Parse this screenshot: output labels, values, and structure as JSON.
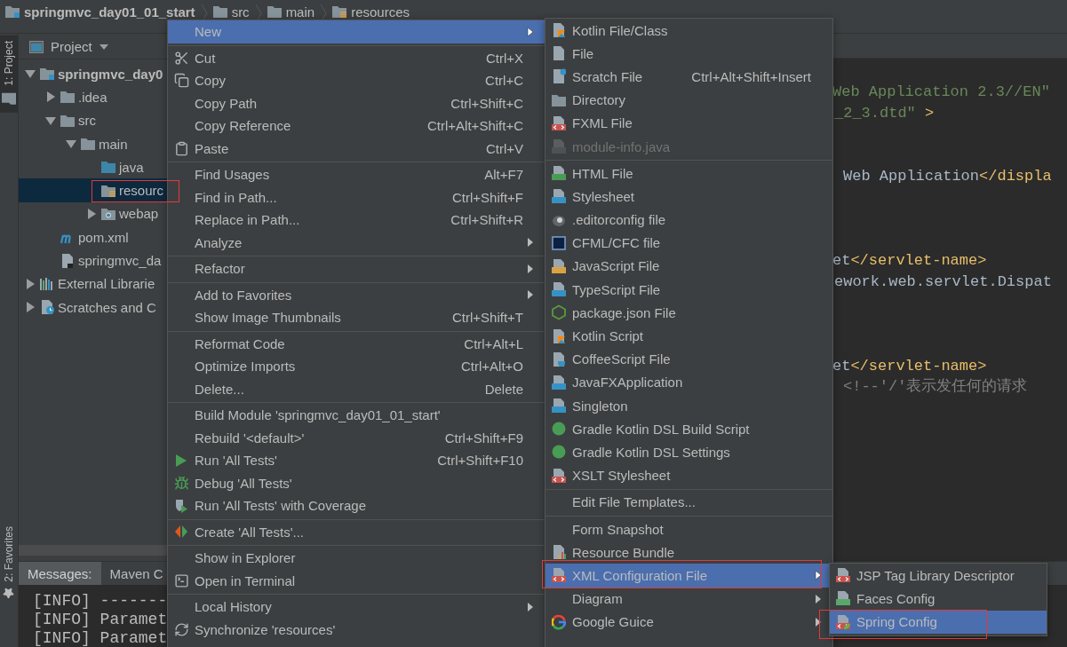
{
  "breadcrumb": [
    {
      "label": "springmvc_day01_01_start",
      "kind": "module"
    },
    {
      "label": "src",
      "kind": "folder"
    },
    {
      "label": "main",
      "kind": "folder"
    },
    {
      "label": "resources",
      "kind": "resources"
    }
  ],
  "side_tabs": [
    {
      "label": "1: Project",
      "kind": "folder",
      "selected": true
    },
    {
      "label": "2: Favorites",
      "kind": "star",
      "selected": false
    }
  ],
  "project_panel": {
    "title": "Project",
    "tree": [
      {
        "label": "springmvc_day0",
        "kind": "module",
        "expanded": true,
        "selected": false,
        "children": [
          {
            "label": ".idea",
            "kind": "folder",
            "expanded": false,
            "selected": false
          },
          {
            "label": "src",
            "kind": "folder",
            "expanded": true,
            "selected": false,
            "children": [
              {
                "label": "main",
                "kind": "folder",
                "expanded": true,
                "selected": false,
                "children": [
                  {
                    "label": "java",
                    "kind": "sources",
                    "selected": false
                  },
                  {
                    "label": "resourc",
                    "kind": "resources",
                    "selected": true
                  },
                  {
                    "label": "webap",
                    "kind": "web",
                    "expanded": false,
                    "selected": false
                  }
                ]
              }
            ]
          },
          {
            "label": "pom.xml",
            "kind": "maven",
            "selected": false
          },
          {
            "label": "springmvc_da",
            "kind": "iml",
            "selected": false
          }
        ]
      },
      {
        "label": "External Librarie",
        "kind": "libraries",
        "expanded": false,
        "selected": false
      },
      {
        "label": "Scratches and C",
        "kind": "scratches",
        "expanded": false,
        "selected": false
      }
    ]
  },
  "editor": {
    "lines": [
      {
        "segments": [
          {
            "text": "Web Application 2.3//EN\"",
            "kind": "string"
          }
        ]
      },
      {
        "segments": [
          {
            "text": "_2_3.dtd\"",
            "kind": "string"
          },
          {
            "text": " >",
            "kind": "tag"
          }
        ]
      },
      {
        "segments": [
          {
            "text": "Web Application",
            "kind": "text"
          },
          {
            "text": "</displa",
            "kind": "tag"
          }
        ]
      },
      {
        "segments": [
          {
            "text": "et",
            "kind": "text"
          },
          {
            "text": "</servlet-name>",
            "kind": "tag"
          }
        ]
      },
      {
        "segments": [
          {
            "text": "ework.web.servlet.Dispat",
            "kind": "text"
          }
        ]
      },
      {
        "segments": [
          {
            "text": "et",
            "kind": "text"
          },
          {
            "text": "</servlet-name>",
            "kind": "tag"
          }
        ]
      },
      {
        "segments": [
          {
            "text": "<!--'/'表示发任何的请求",
            "kind": "comment"
          }
        ]
      }
    ]
  },
  "bottom_panel": {
    "tabs": [
      {
        "label": "Messages:",
        "selected": true
      },
      {
        "label": "Maven C",
        "selected": false
      }
    ],
    "console": [
      "[INFO] -------",
      "[INFO] Paramet",
      "[INFO] Paramet"
    ]
  },
  "context_menu": {
    "items": [
      {
        "kind": "plain",
        "label": "New",
        "submenu": true,
        "selected": true
      },
      {
        "kind": "separator"
      },
      {
        "kind": "cut",
        "label": "Cut",
        "shortcut": "Ctrl+X",
        "selected": false
      },
      {
        "kind": "copy",
        "label": "Copy",
        "shortcut": "Ctrl+C",
        "selected": false
      },
      {
        "kind": "plain",
        "label": "Copy Path",
        "shortcut": "Ctrl+Shift+C",
        "selected": false
      },
      {
        "kind": "plain",
        "label": "Copy Reference",
        "shortcut": "Ctrl+Alt+Shift+C",
        "selected": false
      },
      {
        "kind": "paste",
        "label": "Paste",
        "shortcut": "Ctrl+V",
        "selected": false
      },
      {
        "kind": "separator"
      },
      {
        "kind": "plain",
        "label": "Find Usages",
        "shortcut": "Alt+F7",
        "selected": false
      },
      {
        "kind": "plain",
        "label": "Find in Path...",
        "shortcut": "Ctrl+Shift+F",
        "selected": false
      },
      {
        "kind": "plain",
        "label": "Replace in Path...",
        "shortcut": "Ctrl+Shift+R",
        "selected": false
      },
      {
        "kind": "plain",
        "label": "Analyze",
        "submenu": true,
        "selected": false
      },
      {
        "kind": "separator"
      },
      {
        "kind": "plain",
        "label": "Refactor",
        "submenu": true,
        "selected": false
      },
      {
        "kind": "separator"
      },
      {
        "kind": "plain",
        "label": "Add to Favorites",
        "submenu": true,
        "selected": false
      },
      {
        "kind": "plain",
        "label": "Show Image Thumbnails",
        "shortcut": "Ctrl+Shift+T",
        "selected": false
      },
      {
        "kind": "separator"
      },
      {
        "kind": "plain",
        "label": "Reformat Code",
        "shortcut": "Ctrl+Alt+L",
        "selected": false
      },
      {
        "kind": "plain",
        "label": "Optimize Imports",
        "shortcut": "Ctrl+Alt+O",
        "selected": false
      },
      {
        "kind": "plain",
        "label": "Delete...",
        "shortcut": "Delete",
        "selected": false
      },
      {
        "kind": "separator"
      },
      {
        "kind": "plain",
        "label": "Build Module 'springmvc_day01_01_start'",
        "selected": false
      },
      {
        "kind": "plain",
        "label": "Rebuild '<default>'",
        "shortcut": "Ctrl+Shift+F9",
        "selected": false
      },
      {
        "kind": "run",
        "label": "Run 'All Tests'",
        "shortcut": "Ctrl+Shift+F10",
        "selected": false
      },
      {
        "kind": "debug",
        "label": "Debug 'All Tests'",
        "selected": false
      },
      {
        "kind": "coverage",
        "label": "Run 'All Tests' with Coverage",
        "selected": false
      },
      {
        "kind": "separator"
      },
      {
        "kind": "create",
        "label": "Create 'All Tests'...",
        "selected": false
      },
      {
        "kind": "separator"
      },
      {
        "kind": "plain",
        "label": "Show in Explorer",
        "selected": false
      },
      {
        "kind": "terminal",
        "label": "Open in Terminal",
        "selected": false
      },
      {
        "kind": "separator"
      },
      {
        "kind": "plain",
        "label": "Local History",
        "submenu": true,
        "selected": false
      },
      {
        "kind": "sync",
        "label": "Synchronize 'resources'",
        "selected": false
      }
    ]
  },
  "new_submenu": {
    "items": [
      {
        "kind": "kotlin",
        "label": "Kotlin File/Class",
        "selected": false,
        "disabled": false
      },
      {
        "kind": "file",
        "label": "File",
        "selected": false,
        "disabled": false
      },
      {
        "kind": "scratch",
        "label": "Scratch File",
        "shortcut": "Ctrl+Alt+Shift+Insert",
        "selected": false,
        "disabled": false
      },
      {
        "kind": "folder",
        "label": "Directory",
        "selected": false,
        "disabled": false
      },
      {
        "kind": "fxml",
        "label": "FXML File",
        "selected": false,
        "disabled": false
      },
      {
        "kind": "java",
        "label": "module-info.java",
        "selected": false,
        "disabled": true
      },
      {
        "kind": "separator"
      },
      {
        "kind": "html",
        "label": "HTML File",
        "selected": false,
        "disabled": false
      },
      {
        "kind": "css",
        "label": "Stylesheet",
        "selected": false,
        "disabled": false
      },
      {
        "kind": "editorconfig",
        "label": ".editorconfig file",
        "selected": false,
        "disabled": false
      },
      {
        "kind": "cfml",
        "label": "CFML/CFC file",
        "selected": false,
        "disabled": false
      },
      {
        "kind": "js",
        "label": "JavaScript File",
        "selected": false,
        "disabled": false
      },
      {
        "kind": "ts",
        "label": "TypeScript File",
        "selected": false,
        "disabled": false
      },
      {
        "kind": "nodejs",
        "label": "package.json File",
        "selected": false,
        "disabled": false
      },
      {
        "kind": "kotlinscript",
        "label": "Kotlin Script",
        "selected": false,
        "disabled": false
      },
      {
        "kind": "coffee",
        "label": "CoffeeScript File",
        "selected": false,
        "disabled": false
      },
      {
        "kind": "javafx",
        "label": "JavaFXApplication",
        "selected": false,
        "disabled": false
      },
      {
        "kind": "singleton",
        "label": "Singleton",
        "selected": false,
        "disabled": false
      },
      {
        "kind": "gradle",
        "label": "Gradle Kotlin DSL Build Script",
        "selected": false,
        "disabled": false
      },
      {
        "kind": "gradle",
        "label": "Gradle Kotlin DSL Settings",
        "selected": false,
        "disabled": false
      },
      {
        "kind": "xslt",
        "label": "XSLT Stylesheet",
        "selected": false,
        "disabled": false
      },
      {
        "kind": "separator"
      },
      {
        "kind": "plain",
        "label": "Edit File Templates...",
        "selected": false,
        "disabled": false
      },
      {
        "kind": "separator"
      },
      {
        "kind": "plain",
        "label": "Form Snapshot",
        "selected": false,
        "disabled": false
      },
      {
        "kind": "bundle",
        "label": "Resource Bundle",
        "selected": false,
        "disabled": false
      },
      {
        "kind": "xml",
        "label": "XML Configuration File",
        "submenu": true,
        "selected": true,
        "disabled": false
      },
      {
        "kind": "plain",
        "label": "Diagram",
        "submenu": true,
        "selected": false,
        "disabled": false
      },
      {
        "kind": "google",
        "label": "Google Guice",
        "submenu": true,
        "selected": false,
        "disabled": false
      }
    ]
  },
  "xml_submenu": {
    "items": [
      {
        "kind": "xml",
        "label": "JSP Tag Library Descriptor",
        "selected": false
      },
      {
        "kind": "jsf",
        "label": "Faces Config",
        "selected": false
      },
      {
        "kind": "spring",
        "label": "Spring Config",
        "selected": true
      }
    ]
  }
}
